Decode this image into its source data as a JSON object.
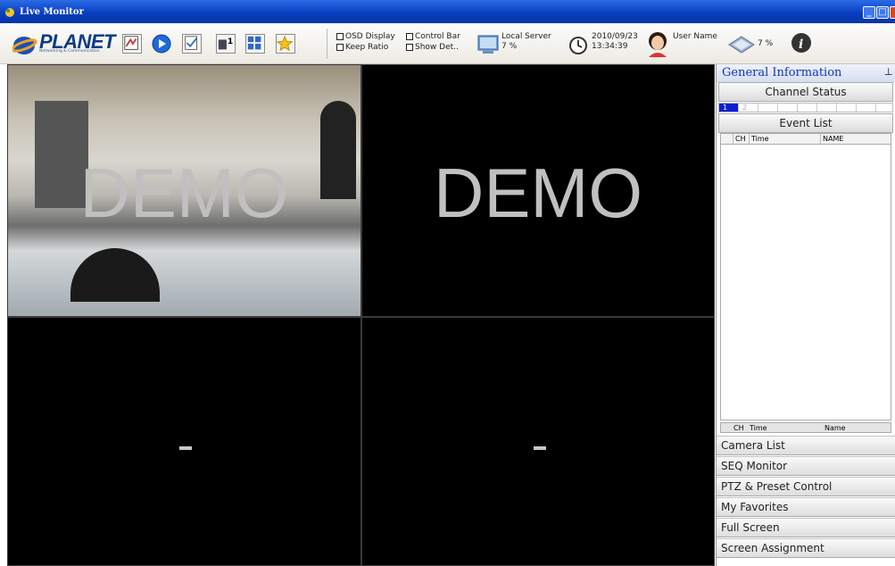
{
  "window": {
    "title": "Live Monitor",
    "buttons": [
      "minimize",
      "maximize",
      "close"
    ]
  },
  "logo": {
    "brand": "PLANET",
    "tagline": "Networking & Communication"
  },
  "toolbar": {
    "icons": [
      "map-icon",
      "play-icon",
      "log-icon",
      "single-view-icon",
      "layout-icon",
      "favorite-star-icon"
    ],
    "options": [
      {
        "label": "OSD Display",
        "checked": false
      },
      {
        "label": "Control Bar",
        "checked": false
      },
      {
        "label": "Keep Ratio",
        "checked": false
      },
      {
        "label": "Show Det..",
        "checked": false
      }
    ],
    "server": {
      "name": "Local Server",
      "cpu": "7 %"
    },
    "datetime": {
      "date": "2010/09/23",
      "time": "13:34:39"
    },
    "user": {
      "name": "User Name"
    },
    "network": {
      "value": "7 %"
    }
  },
  "video": {
    "cells": [
      {
        "overlay": "DEMO",
        "has_image": true
      },
      {
        "overlay": "DEMO",
        "has_image": false
      },
      {
        "overlay": "-",
        "has_image": false
      },
      {
        "overlay": "-",
        "has_image": false
      }
    ]
  },
  "sidebar": {
    "title": "General Information",
    "channel_status": {
      "label": "Channel Status",
      "channels": [
        {
          "num": "1",
          "active": true
        },
        {
          "num": "2",
          "active": false
        },
        {
          "num": "",
          "active": false
        },
        {
          "num": "",
          "active": false
        },
        {
          "num": "",
          "active": false
        },
        {
          "num": "",
          "active": false
        },
        {
          "num": "",
          "active": false
        },
        {
          "num": "",
          "active": false
        }
      ]
    },
    "event_list": {
      "label": "Event List",
      "columns": [
        "CH",
        "Time",
        "NAME"
      ],
      "footer_columns": [
        "CH",
        "Time",
        "Name"
      ]
    },
    "accordion": [
      "Camera List",
      "SEQ Monitor",
      "PTZ & Preset Control",
      "My Favorites",
      "Full Screen",
      "Screen Assignment"
    ]
  }
}
